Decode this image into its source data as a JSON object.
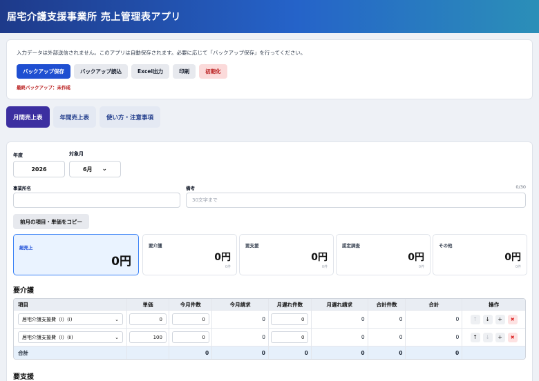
{
  "header": {
    "title": "居宅介護支援事業所 売上管理表アプリ"
  },
  "notice": {
    "text": "入力データは外部送信されません。このアプリは自動保存されます。必要に応じて「バックアップ保存」を行ってください。",
    "buttons": {
      "backup_save": "バックアップ保存",
      "backup_load": "バックアップ読込",
      "excel": "Excel出力",
      "print": "印刷",
      "reset": "初期化"
    },
    "last_backup": "最終バックアップ：未作成"
  },
  "tabs": [
    "月間売上表",
    "年間売上表",
    "使い方・注意事項"
  ],
  "form": {
    "year_label": "年度",
    "year_value": "2026",
    "month_label": "対象月",
    "month_value": "6月",
    "office_label": "事業所名",
    "office_value": "",
    "note_label": "備考",
    "note_placeholder": "30文字まで",
    "note_counter": "0/30",
    "copy_button": "前月の項目・単価をコピー"
  },
  "summary": {
    "total": {
      "label": "総売上",
      "value": "0円"
    },
    "cards": [
      {
        "label": "要介護",
        "value": "0円",
        "count": "0件"
      },
      {
        "label": "要支援",
        "value": "0円",
        "count": "0件"
      },
      {
        "label": "認定調査",
        "value": "0円",
        "count": "0件"
      },
      {
        "label": "その他",
        "value": "0円",
        "count": "0件"
      }
    ]
  },
  "sections": {
    "kaigo": "要介護",
    "shien": "要支援"
  },
  "table": {
    "headers": [
      "項目",
      "単価",
      "今月件数",
      "今月請求",
      "月遅れ件数",
      "月遅れ請求",
      "合計件数",
      "合計",
      "操作"
    ],
    "rows": [
      {
        "item": "居宅介護支援費（Ⅰ）(ⅰ)",
        "unit_price": "0",
        "count": "0",
        "billing": "0",
        "late_count": "0",
        "late_billing": "0",
        "total_count": "0",
        "total": "0"
      },
      {
        "item": "居宅介護支援費（Ⅰ）(ⅱ)",
        "unit_price": "100",
        "count": "0",
        "billing": "0",
        "late_count": "0",
        "late_billing": "0",
        "total_count": "0",
        "total": "0"
      }
    ],
    "totals": {
      "label": "合計",
      "count": "0",
      "billing": "0",
      "late_count": "0",
      "late_billing": "0",
      "total_count": "0",
      "total": "0"
    }
  }
}
